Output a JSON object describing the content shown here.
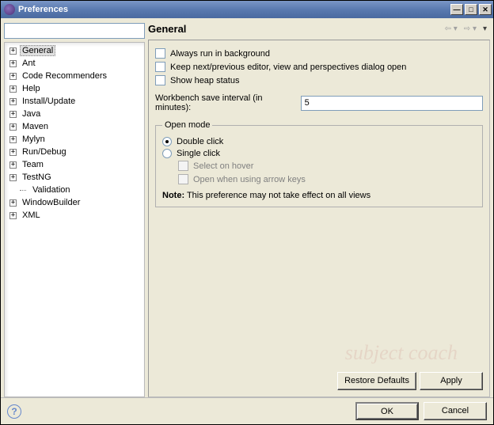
{
  "window": {
    "title": "Preferences"
  },
  "tree": {
    "items": [
      {
        "label": "General",
        "expandable": true,
        "selected": true
      },
      {
        "label": "Ant",
        "expandable": true
      },
      {
        "label": "Code Recommenders",
        "expandable": true
      },
      {
        "label": "Help",
        "expandable": true
      },
      {
        "label": "Install/Update",
        "expandable": true
      },
      {
        "label": "Java",
        "expandable": true
      },
      {
        "label": "Maven",
        "expandable": true
      },
      {
        "label": "Mylyn",
        "expandable": true
      },
      {
        "label": "Run/Debug",
        "expandable": true
      },
      {
        "label": "Team",
        "expandable": true
      },
      {
        "label": "TestNG",
        "expandable": true
      },
      {
        "label": "Validation",
        "expandable": false
      },
      {
        "label": "WindowBuilder",
        "expandable": true
      },
      {
        "label": "XML",
        "expandable": true
      }
    ]
  },
  "page": {
    "heading": "General",
    "check1": "Always run in background",
    "check2": "Keep next/previous editor, view and perspectives dialog open",
    "check3": "Show heap status",
    "interval_label": "Workbench save interval (in minutes):",
    "interval_value": "5",
    "openmode": {
      "legend": "Open mode",
      "opt_double": "Double click",
      "opt_single": "Single click",
      "sub_hover": "Select on hover",
      "sub_arrow": "Open when using arrow keys",
      "note_label": "Note:",
      "note_text": " This preference may not take effect on all views"
    },
    "buttons": {
      "restore": "Restore Defaults",
      "apply": "Apply",
      "ok": "OK",
      "cancel": "Cancel"
    }
  },
  "filter": {
    "placeholder": ""
  },
  "watermark": "subject coach"
}
